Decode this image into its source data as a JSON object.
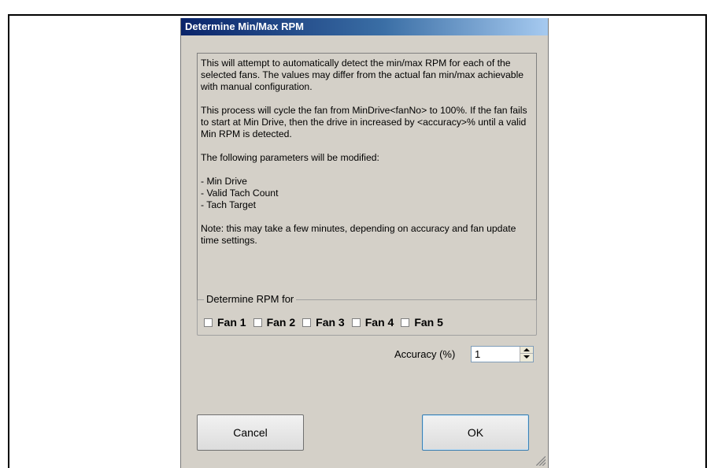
{
  "dialog": {
    "title": "Determine Min/Max RPM"
  },
  "info": {
    "para1": "This will attempt to automatically detect the min/max RPM for each of the selected fans. The values may differ from the actual fan min/max achievable with manual configuration.",
    "para2": "This process will cycle the fan from MinDrive<fanNo> to 100%. If the fan fails to start at Min Drive, then the drive in increased by <accuracy>% until a valid Min RPM is detected.",
    "para3": "The following parameters will be modified:",
    "items": [
      " - Min Drive",
      " - Valid Tach Count",
      " - Tach Target"
    ],
    "note": "Note: this may take a few minutes, depending on accuracy and fan update time settings."
  },
  "group": {
    "legend": "Determine RPM for",
    "fans": [
      {
        "label": "Fan 1",
        "checked": false
      },
      {
        "label": "Fan 2",
        "checked": false
      },
      {
        "label": "Fan 3",
        "checked": false
      },
      {
        "label": "Fan 4",
        "checked": false
      },
      {
        "label": "Fan 5",
        "checked": false
      }
    ]
  },
  "accuracy": {
    "label": "Accuracy (%)",
    "value": "1"
  },
  "buttons": {
    "cancel": "Cancel",
    "ok": "OK"
  }
}
